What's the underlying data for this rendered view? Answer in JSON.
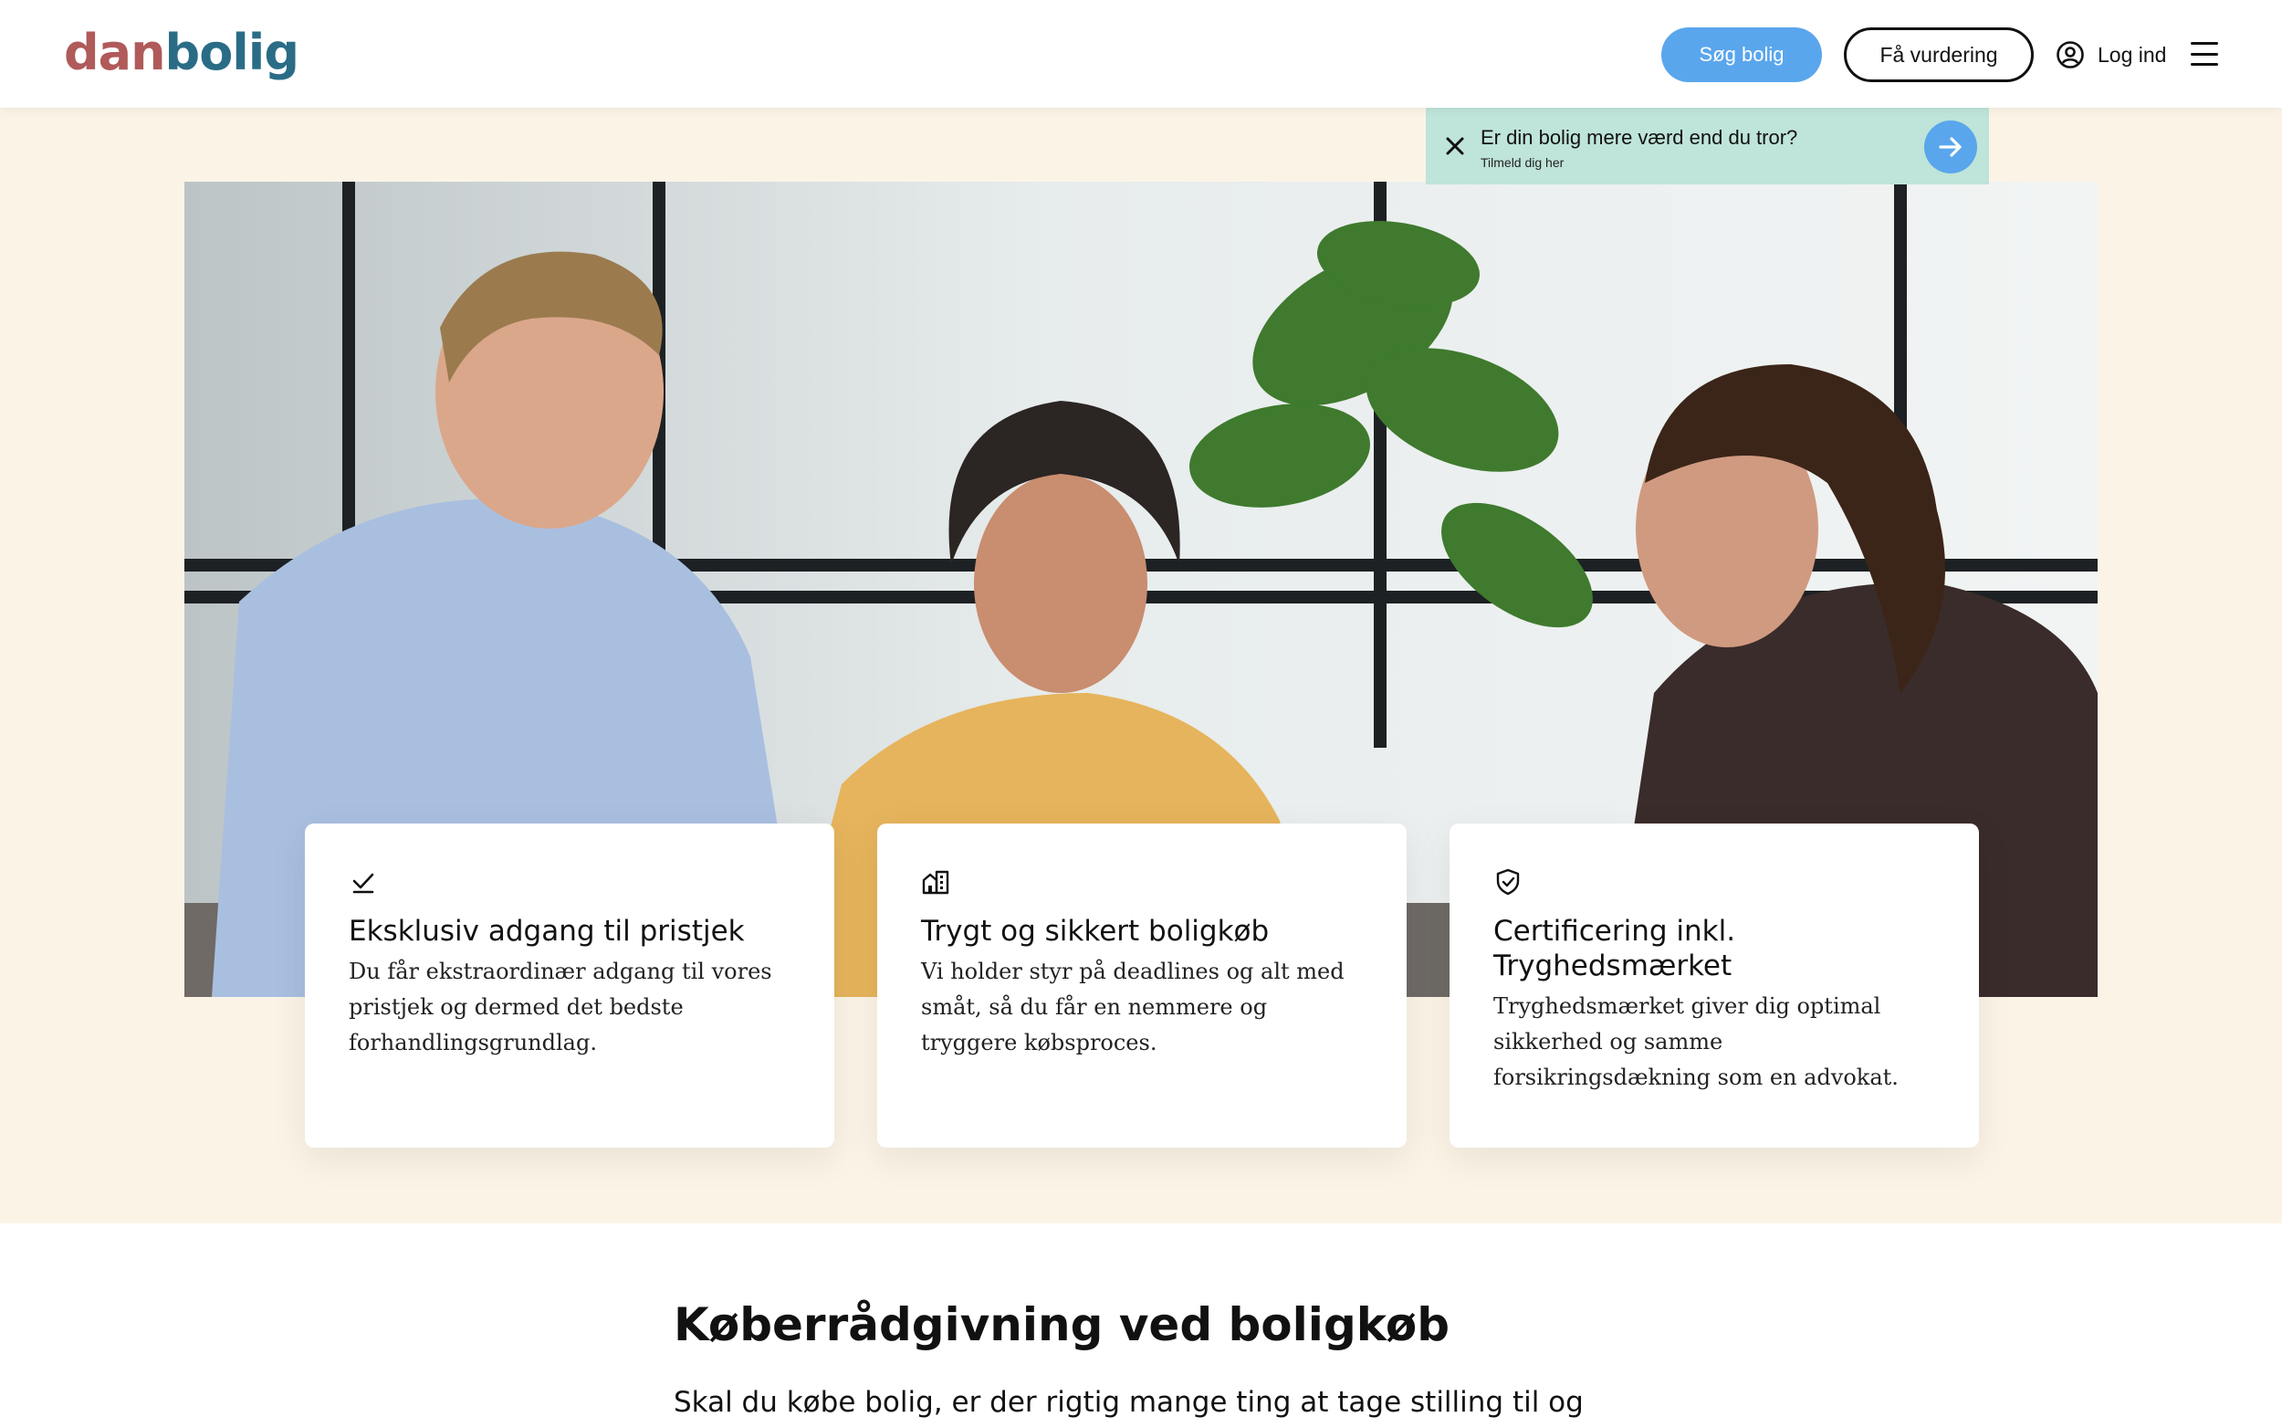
{
  "header": {
    "logo_part1": "dan",
    "logo_part2": "bolig",
    "search_button": "Søg bolig",
    "valuation_button": "Få vurdering",
    "login_label": "Log ind"
  },
  "banner": {
    "title": "Er din bolig mere værd end du tror?",
    "subtitle": "Tilmeld dig her"
  },
  "cards": [
    {
      "title": "Eksklusiv adgang til pristjek",
      "text": "Du får ekstraordinær adgang til vores pristjek og dermed det bedste forhandlingsgrundlag.",
      "icon": "checkmark-icon"
    },
    {
      "title": "Trygt og sikkert boligkøb",
      "text": "Vi holder styr på deadlines og alt med småt, så du får en nemmere og tryggere købsproces.",
      "icon": "buildings-icon"
    },
    {
      "title": "Certificering inkl. Tryghedsmærket",
      "text": "Tryghedsmærket giver dig optimal sikkerhed og samme forsikringsdækning som en advokat.",
      "icon": "shield-check-icon"
    }
  ],
  "section": {
    "title": "Køberrådgivning ved boligkøb",
    "intro": "Skal du købe bolig, er der rigtig mange ting at tage stilling til og"
  },
  "colors": {
    "logo_red": "#b05a5a",
    "logo_blue": "#2a6c86",
    "accent_blue": "#5aa6ec",
    "banner_green": "#bfe4d9",
    "beige_bg": "#fbf4e6"
  }
}
